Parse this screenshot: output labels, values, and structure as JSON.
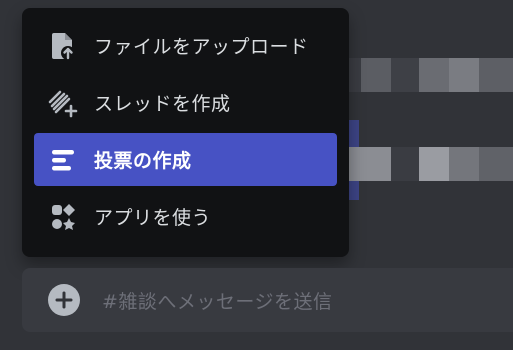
{
  "menu": {
    "items": [
      {
        "label": "ファイルをアップロード",
        "icon": "upload-file-icon",
        "active": false
      },
      {
        "label": "スレッドを作成",
        "icon": "thread-icon",
        "active": false
      },
      {
        "label": "投票の作成",
        "icon": "poll-icon",
        "active": true
      },
      {
        "label": "アプリを使う",
        "icon": "apps-icon",
        "active": false
      }
    ]
  },
  "chat": {
    "placeholder": "#雑談へメッセージを送信",
    "plus_icon": "plus-circle-icon"
  },
  "colors": {
    "background": "#313338",
    "menu_bg": "#111214",
    "active_item": "#4752c4",
    "input_bg": "#383a40",
    "icon_fill": "#b5bac1"
  }
}
